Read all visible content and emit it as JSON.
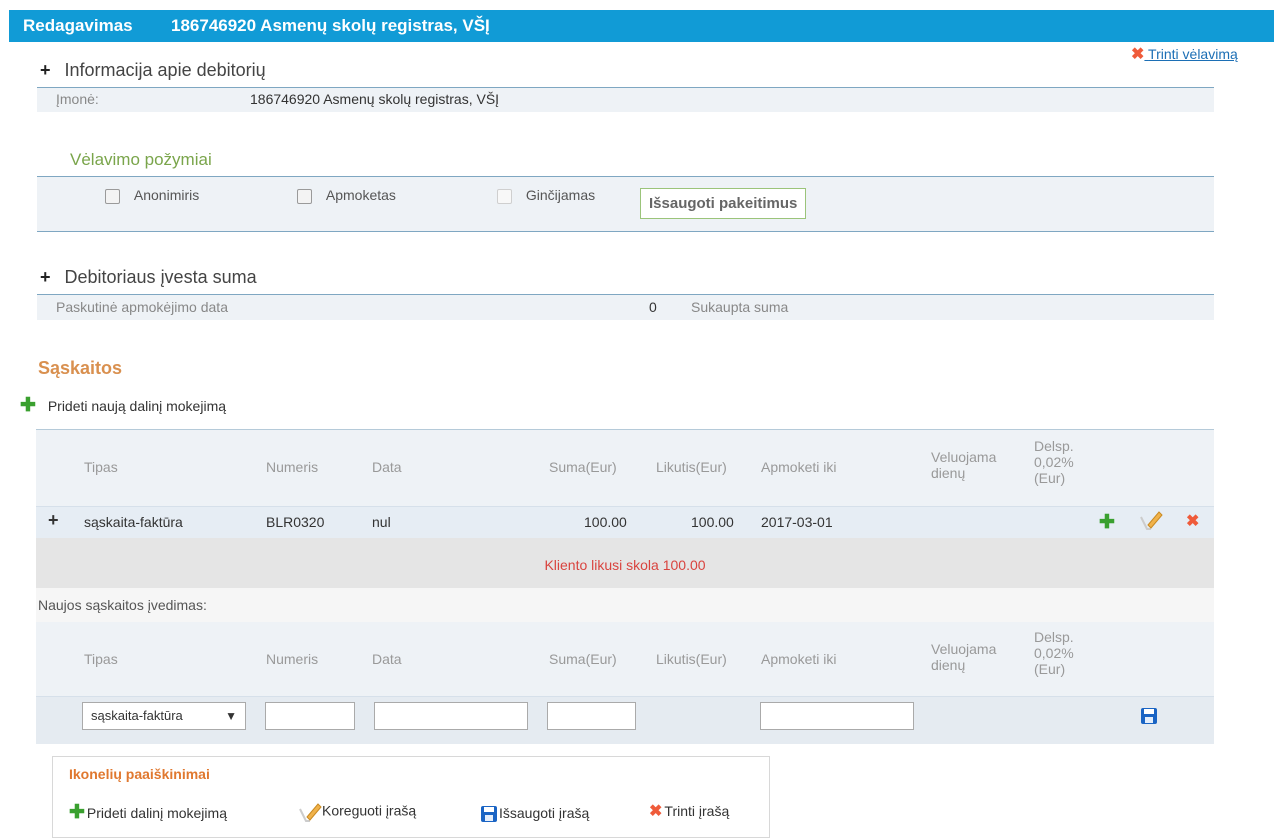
{
  "header": {
    "action": "Redagavimas",
    "title": "186746920 Asmenų skolų registras, VŠĮ"
  },
  "delete_delay_link": "Trinti vėlavimą",
  "debtor_info": {
    "title": "Informacija apie debitorių",
    "company_label": "Įmonė:",
    "company_value": "186746920 Asmenų skolų registras, VŠĮ"
  },
  "delay_flags": {
    "title": "Vėlavimo požymiai",
    "checkbox_anonymous": "Anonimiris",
    "checkbox_paid": "Apmoketas",
    "checkbox_disputed": "Ginčijamas",
    "save_button": "Išsaugoti pakeitimus"
  },
  "debtor_sum": {
    "title": "Debitoriaus įvesta suma",
    "last_payment_label": "Paskutinė apmokėjimo data",
    "value": "0",
    "accumulated_label": "Sukaupta suma"
  },
  "invoices": {
    "title": "Sąskaitos",
    "add_partial_payment": "Prideti naują dalinį mokejimą",
    "columns": {
      "type": "Tipas",
      "number": "Numeris",
      "date": "Data",
      "sum": "Suma(Eur)",
      "remaining": "Likutis(Eur)",
      "pay_by": "Apmoketi iki",
      "late_days_1": "Veluojama",
      "late_days_2": "dienų",
      "delay_1": "Delsp.",
      "delay_2": "0,02%",
      "delay_3": "(Eur)"
    },
    "row": {
      "type": "sąskaita-faktūra",
      "number": "BLR0320",
      "date": "nul",
      "sum": "100.00",
      "remaining": "100.00",
      "pay_by": "2017-03-01"
    },
    "client_debt": "Kliento likusi skola 100.00",
    "new_invoice_label": "Naujos sąskaitos įvedimas:",
    "new_type_selected": "sąskaita-faktūra"
  },
  "legend": {
    "title": "Ikonelių paaiškinimai",
    "add": "Prideti dalinį mokejimą",
    "edit": "Koreguoti įrašą",
    "save": "Išsaugoti įrašą",
    "delete": "Trinti įrašą"
  },
  "colors": {
    "header_bg": "#119bd6",
    "accent_green": "#7aa54b",
    "accent_orange": "#d9904f",
    "debt_red": "#d9443f"
  }
}
